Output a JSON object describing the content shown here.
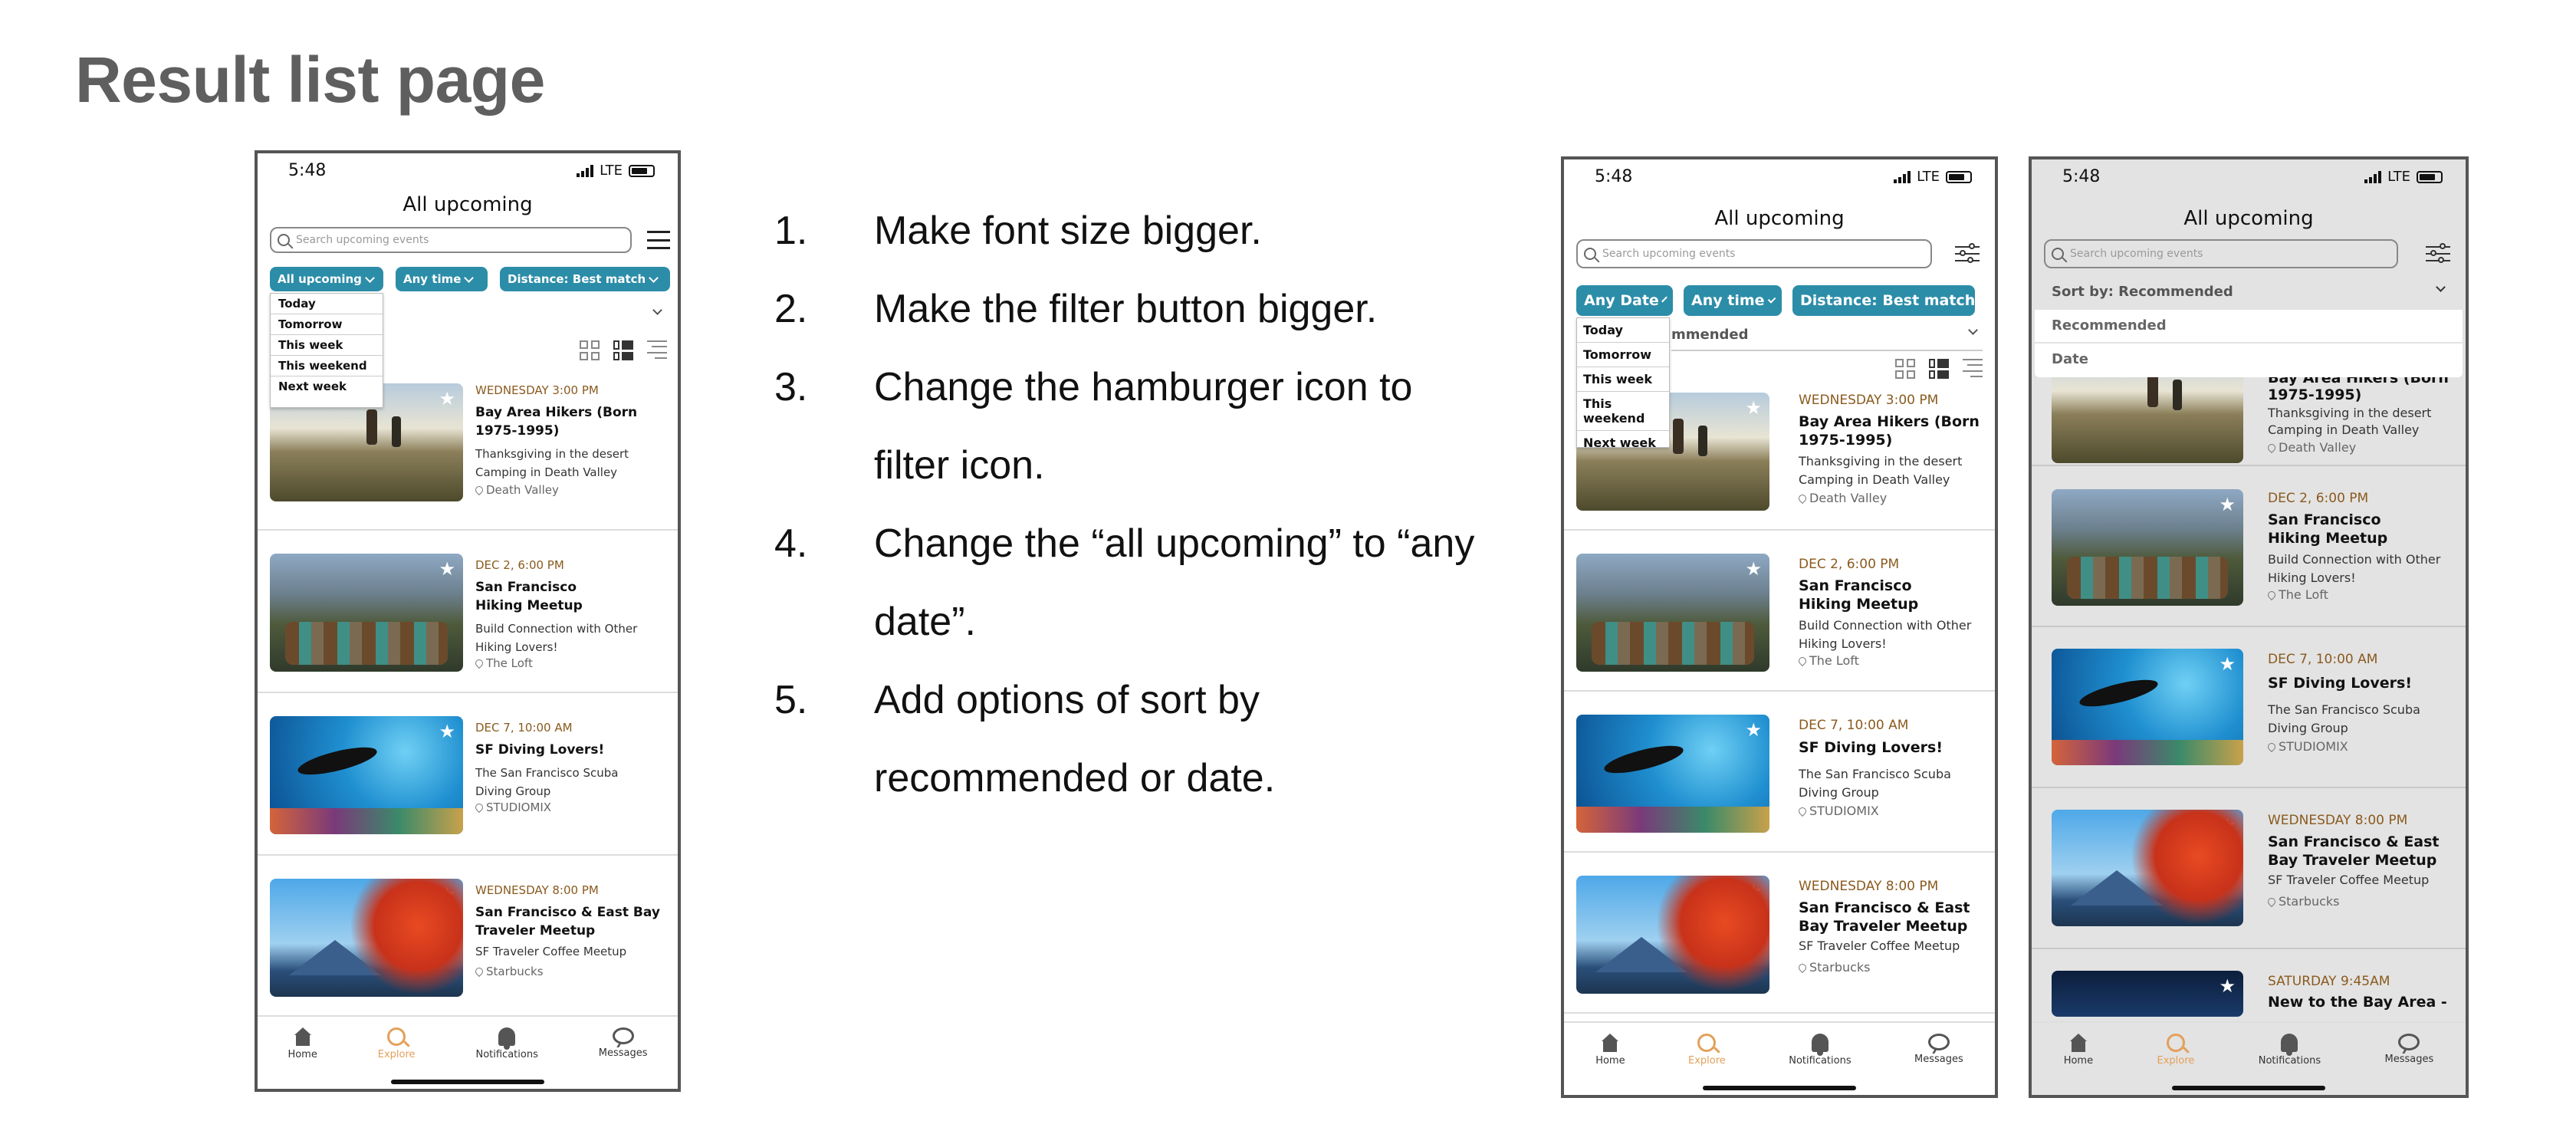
{
  "page": {
    "title": "Result list page"
  },
  "notes": [
    {
      "num": "1.",
      "text": "Make font size bigger."
    },
    {
      "num": "2.",
      "text": "Make the filter button bigger."
    },
    {
      "num": "3.",
      "text": "Change the hamburger icon to filter icon."
    },
    {
      "num": "4.",
      "text": "Change the “all upcoming” to “any date”."
    },
    {
      "num": "5.",
      "text": "Add options of sort by recommended or date."
    }
  ],
  "status": {
    "time": "5:48",
    "network": "LTE"
  },
  "search_placeholder": "Search upcoming events",
  "phone1": {
    "title": "All upcoming",
    "chips": [
      "All upcoming",
      "Any time",
      "Distance: Best match"
    ],
    "dropdown": [
      "Today",
      "Tomorrow",
      "This week",
      "This weekend",
      "Next week"
    ]
  },
  "phone2": {
    "title": "All upcoming",
    "chips": [
      "Any Date",
      "Any time",
      "Distance: Best match"
    ],
    "dropdown": [
      "Today",
      "Tomorrow",
      "This week",
      "This weekend",
      "Next week"
    ],
    "sort_fragment": "mmended"
  },
  "phone3": {
    "title": "All upcoming",
    "sort_label": "Sort by: Recommended",
    "sort_options": [
      "Recommended",
      "Date"
    ],
    "partial_event": {
      "when": "SATURDAY 9:45AM",
      "name": "New to the Bay Area -"
    }
  },
  "events": [
    {
      "when": "WEDNESDAY 3:00 PM",
      "name": "Bay Area Hikers (Born 1975-1995)",
      "name_split": [
        "Bay Area Hikers (Born",
        "1975-1995)"
      ],
      "desc": [
        "Thanksgiving in the desert",
        "Camping in Death Valley"
      ],
      "loc": "Death Valley",
      "thumb": "hikers-photo"
    },
    {
      "when": "DEC 2, 6:00 PM",
      "name_split": [
        "San Francisco",
        "Hiking Meetup"
      ],
      "desc": [
        "Build Connection with Other",
        "Hiking Lovers!"
      ],
      "loc": "The Loft",
      "thumb": "boots-photo"
    },
    {
      "when": "DEC 7, 10:00 AM",
      "name_split": [
        "SF Diving Lovers!"
      ],
      "desc": [
        "The San Francisco Scuba",
        "Diving Group"
      ],
      "loc": "STUDIOMIX",
      "thumb": "diver-photo"
    },
    {
      "when": "WEDNESDAY 8:00 PM",
      "name_split": [
        "San Francisco & East Bay",
        "Traveler Meetup"
      ],
      "name_split_b": [
        "San Francisco & East",
        "Bay Traveler Meetup"
      ],
      "desc": [
        "SF Traveler Coffee Meetup"
      ],
      "loc": "Starbucks",
      "thumb": "fuji-photo"
    }
  ],
  "tabs": [
    {
      "label": "Home",
      "icon": "home-icon",
      "active": false
    },
    {
      "label": "Explore",
      "icon": "search-icon",
      "active": true
    },
    {
      "label": "Notifications",
      "icon": "bell-icon",
      "active": false
    },
    {
      "label": "Messages",
      "icon": "message-icon",
      "active": false
    }
  ],
  "colors": {
    "chip": "#2c8da8",
    "date_text": "#8a5a1e",
    "active_tab": "#e3a05a",
    "title_gray": "#5f5f5f"
  }
}
